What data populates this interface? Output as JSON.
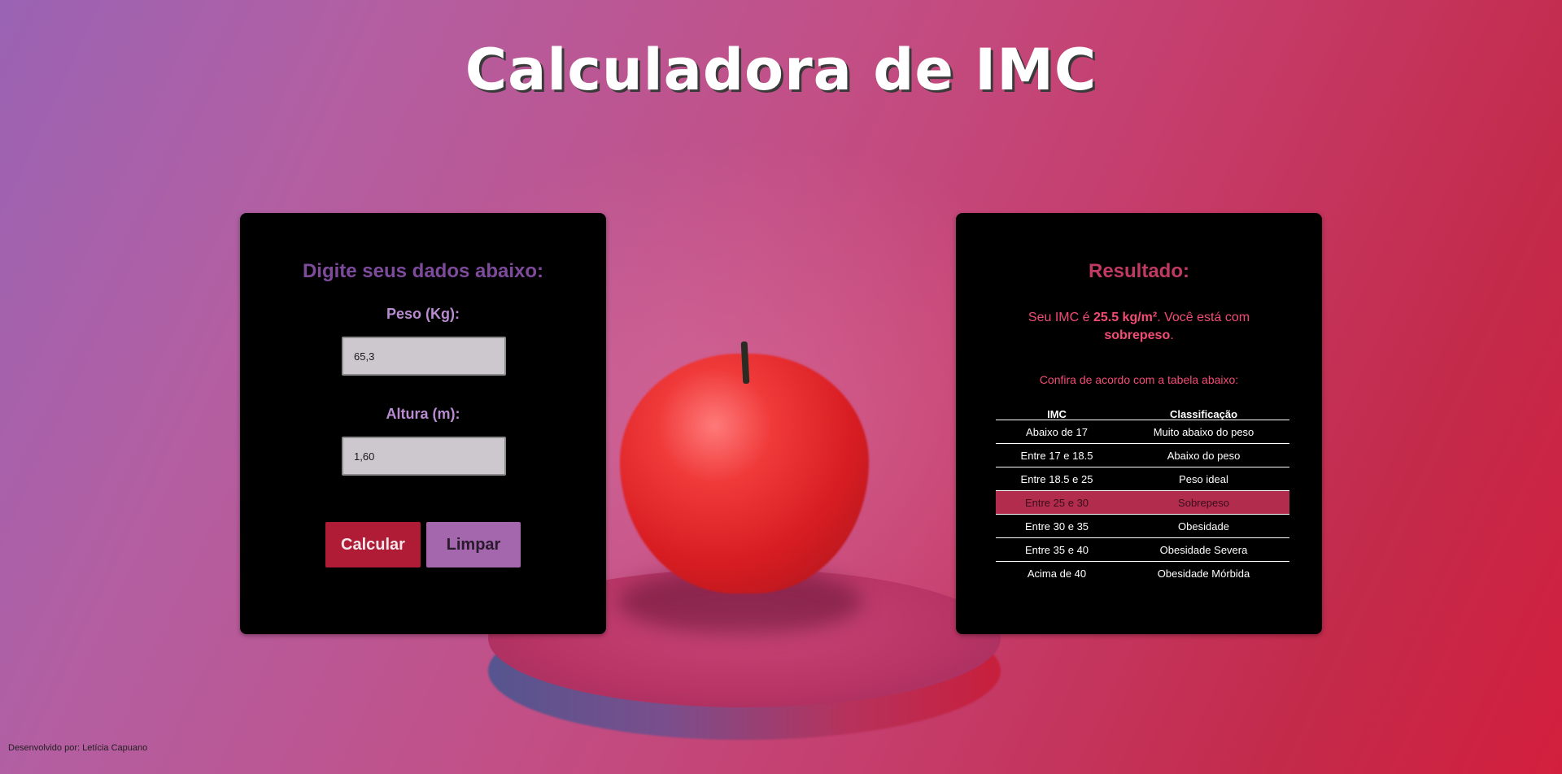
{
  "page": {
    "title": "Calculadora de IMC",
    "footer": "Desenvolvido por: Letícia Capuano"
  },
  "form": {
    "heading": "Digite seus dados abaixo:",
    "weight_label": "Peso (Kg):",
    "weight_value": "65,3",
    "height_label": "Altura (m):",
    "height_value": "1,60",
    "calc_button": "Calcular",
    "clear_button": "Limpar"
  },
  "result": {
    "heading": "Resultado:",
    "text_prefix": "Seu IMC é ",
    "imc_value": "25.5 kg/m²",
    "text_middle": ". Você está com ",
    "classification": "sobrepeso",
    "text_suffix": ".",
    "note": "Confira de acordo com a tabela abaixo:",
    "table_headers": [
      "IMC",
      "Classificação"
    ],
    "table_rows": [
      {
        "imc": "Abaixo de 17",
        "class": "Muito abaixo do peso"
      },
      {
        "imc": "Entre 17 e 18.5",
        "class": "Abaixo do peso"
      },
      {
        "imc": "Entre 18.5 e 25",
        "class": "Peso ideal"
      },
      {
        "imc": "Entre 25 e 30",
        "class": "Sobrepeso"
      },
      {
        "imc": "Entre 30 e 35",
        "class": "Obesidade"
      },
      {
        "imc": "Entre 35 e 40",
        "class": "Obesidade Severa"
      },
      {
        "imc": "Acima de 40",
        "class": "Obesidade Mórbida"
      }
    ],
    "highlight_row": 3
  },
  "colors": {
    "accent_red": "#b01b36",
    "accent_purple": "#a466ac",
    "result_text": "#f24c74",
    "highlight": "#b22c4d"
  }
}
